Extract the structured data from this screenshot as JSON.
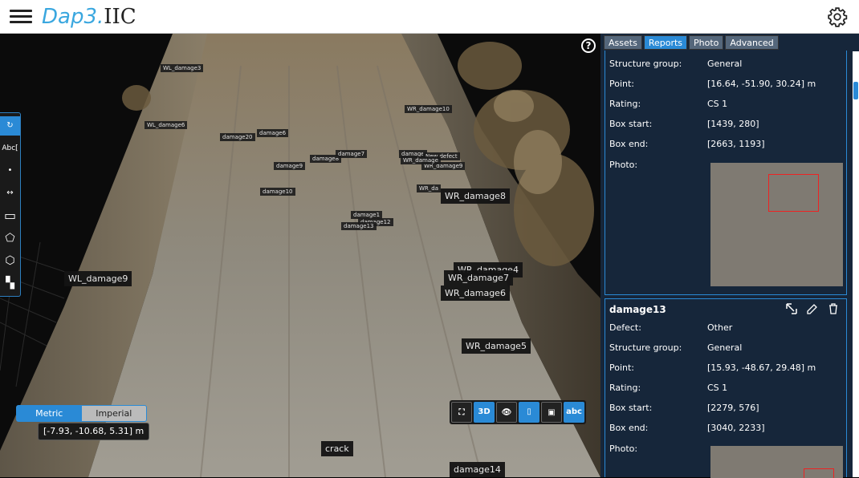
{
  "app": {
    "logo_part1": "Dap3.",
    "logo_part2": "IIC"
  },
  "viewport": {
    "help_label": "?",
    "defect_labels": [
      {
        "text": "WL_damage3",
        "big": false
      },
      {
        "text": "WL_damage6",
        "big": false
      },
      {
        "text": "damage20",
        "big": false
      },
      {
        "text": "damage6",
        "big": false
      },
      {
        "text": "damage9",
        "big": false
      },
      {
        "text": "damage8",
        "big": false
      },
      {
        "text": "damage7",
        "big": false
      },
      {
        "text": "damage",
        "big": false
      },
      {
        "text": "New defect",
        "big": false
      },
      {
        "text": "WR_damage9",
        "big": false
      },
      {
        "text": "WR_damage10",
        "big": false
      },
      {
        "text": "WR_damage",
        "big": false
      },
      {
        "text": "damage10",
        "big": false
      },
      {
        "text": "WR_da",
        "big": false
      },
      {
        "text": "WR_damage8",
        "big": true
      },
      {
        "text": "damage1",
        "big": false
      },
      {
        "text": "damage12",
        "big": false
      },
      {
        "text": "damage13",
        "big": false
      },
      {
        "text": "WL_damage9",
        "big": true
      },
      {
        "text": "WR_damage4",
        "big": true
      },
      {
        "text": "WR_damage7",
        "big": true
      },
      {
        "text": "WR_damage6",
        "big": true
      },
      {
        "text": "WR_damage5",
        "big": true
      },
      {
        "text": "crack",
        "big": true
      },
      {
        "text": "damage14",
        "big": true
      }
    ],
    "toolbar": {
      "rotate": "↻",
      "abc": "Abc[",
      "point": "•",
      "distance": "↔",
      "rect": "▭",
      "polygon": "⬠",
      "box": "⬡",
      "checker": "▚"
    },
    "units": {
      "metric": "Metric",
      "imperial": "Imperial",
      "active": "metric"
    },
    "coordinates": "[-7.93, -10.68, 5.31] m",
    "view_tools": [
      "⛶",
      "3D",
      "👁",
      "▯",
      "▣",
      "abc"
    ]
  },
  "panel": {
    "tabs": [
      {
        "label": "Assets",
        "active": false
      },
      {
        "label": "Reports",
        "active": true
      },
      {
        "label": "Photo",
        "active": false
      },
      {
        "label": "Advanced",
        "active": false
      }
    ],
    "card1": {
      "rows": [
        {
          "k": "Structure group:",
          "v": "General"
        },
        {
          "k": "Point:",
          "v": "[16.64, -51.90, 30.24] m"
        },
        {
          "k": "Rating:",
          "v": "CS 1"
        },
        {
          "k": "Box start:",
          "v": "[1439, 280]"
        },
        {
          "k": "Box end:",
          "v": "[2663, 1193]"
        },
        {
          "k": "Photo:",
          "v": ""
        }
      ]
    },
    "card2": {
      "title": "damage13",
      "rows": [
        {
          "k": "Defect:",
          "v": "Other"
        },
        {
          "k": "Structure group:",
          "v": "General"
        },
        {
          "k": "Point:",
          "v": "[15.93, -48.67, 29.48] m"
        },
        {
          "k": "Rating:",
          "v": "CS 1"
        },
        {
          "k": "Box start:",
          "v": "[2279, 576]"
        },
        {
          "k": "Box end:",
          "v": "[3040, 2233]"
        },
        {
          "k": "Photo:",
          "v": ""
        }
      ]
    }
  },
  "colors": {
    "accent": "#2a8ad6",
    "panel_bg": "#16263a",
    "logo_blue": "#3aa7df"
  }
}
